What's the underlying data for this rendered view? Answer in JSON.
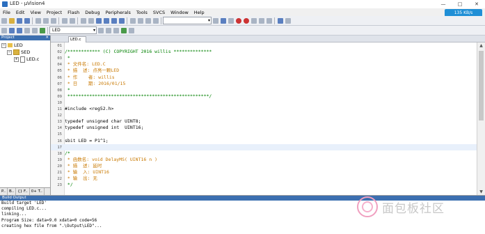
{
  "window": {
    "title": "LED - µVision4",
    "buttons": [
      "—",
      "□",
      "✕"
    ]
  },
  "menu": [
    "File",
    "Edit",
    "View",
    "Project",
    "Flash",
    "Debug",
    "Peripherals",
    "Tools",
    "SVCS",
    "Window",
    "Help"
  ],
  "network_badge": "135 KB/s",
  "toolbar2": {
    "target": "LED"
  },
  "project_panel": {
    "title": "Project",
    "tree": {
      "root": "LED",
      "group": "SED",
      "file": "LED.c"
    },
    "tabs": [
      "P..",
      "B..",
      "{} F..",
      "0+ T.."
    ]
  },
  "editor": {
    "tab": "LED.c",
    "lines": [
      {
        "n": "01",
        "text": "",
        "kind": "code"
      },
      {
        "n": "02",
        "text": "/************ (C) COPYRIGHT 2016 willis **************",
        "kind": "comment"
      },
      {
        "n": "03",
        "text": " *",
        "kind": "comment"
      },
      {
        "n": "04",
        "text": " * 文件名: LED.C",
        "kind": "cn"
      },
      {
        "n": "05",
        "text": " * 描  述: 点亮一颗LED",
        "kind": "cn"
      },
      {
        "n": "06",
        "text": " * 作    者: willis",
        "kind": "cn"
      },
      {
        "n": "07",
        "text": " * 日    期: 2016/01/15",
        "kind": "cn"
      },
      {
        "n": "08",
        "text": " *",
        "kind": "comment"
      },
      {
        "n": "09",
        "text": " ****************************************************/",
        "kind": "comment"
      },
      {
        "n": "10",
        "text": "",
        "kind": "code"
      },
      {
        "n": "11",
        "text": "#include <reg52.h>",
        "kind": "code"
      },
      {
        "n": "12",
        "text": "",
        "kind": "code"
      },
      {
        "n": "13",
        "text": "typedef unsigned char UINT8;",
        "kind": "code"
      },
      {
        "n": "14",
        "text": "typedef unsigned int  UINT16;",
        "kind": "code"
      },
      {
        "n": "15",
        "text": "",
        "kind": "code"
      },
      {
        "n": "16",
        "text": "sbit LED = P1^1;",
        "kind": "code"
      },
      {
        "n": "17",
        "text": "",
        "kind": "code",
        "highlight": true
      },
      {
        "n": "18",
        "text": "/*",
        "kind": "comment"
      },
      {
        "n": "19",
        "text": " * 函数名: void DelayMS( UINT16 n )",
        "kind": "cn"
      },
      {
        "n": "20",
        "text": " * 描  述: 延时",
        "kind": "cn"
      },
      {
        "n": "21",
        "text": " * 输  入: UINT16",
        "kind": "cn"
      },
      {
        "n": "22",
        "text": " * 输  出: 无",
        "kind": "cn"
      },
      {
        "n": "23",
        "text": " */",
        "kind": "comment"
      }
    ]
  },
  "build_output": {
    "title": "Build Output",
    "lines": [
      "Build target 'LED'",
      "compiling LED.c...",
      "linking...",
      "Program Size: data=9.0 xdata=0 code=56",
      "creating hex file from \".\\Output\\LED\"..."
    ]
  },
  "watermark": "面包板社区"
}
